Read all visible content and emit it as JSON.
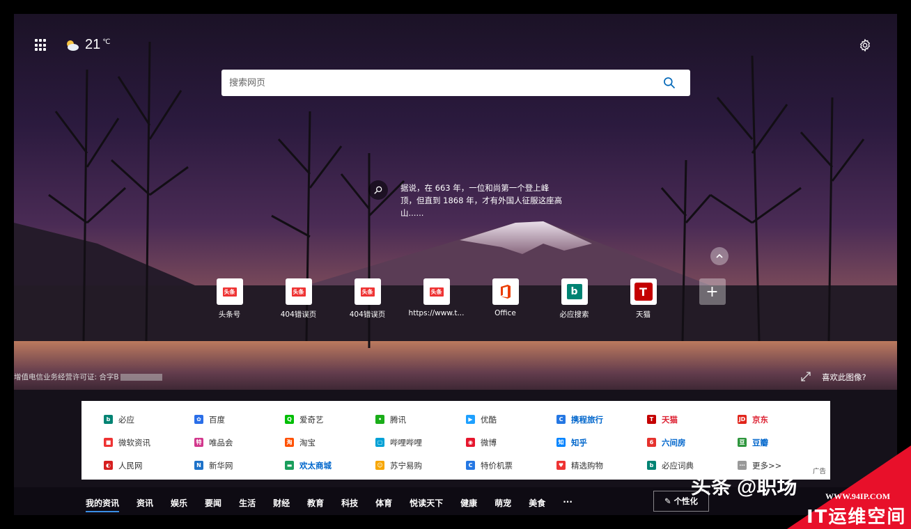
{
  "weather": {
    "temperature": "21",
    "unit": "℃",
    "icon": "partly-cloudy-icon"
  },
  "search": {
    "placeholder": "搜索网页"
  },
  "fact": {
    "text": "据说，在 663 年，一位和尚第一个登上峰顶，但直到 1868 年，才有外国人征服这座高山......"
  },
  "tiles": [
    {
      "label": "头条号",
      "icon": "toutiao-icon"
    },
    {
      "label": "404错误页",
      "icon": "toutiao-icon"
    },
    {
      "label": "404错误页",
      "icon": "toutiao-icon"
    },
    {
      "label": "https://www.t...",
      "icon": "toutiao-icon"
    },
    {
      "label": "Office",
      "icon": "office-icon"
    },
    {
      "label": "必应搜索",
      "icon": "bing-icon"
    },
    {
      "label": "天猫",
      "icon": "tmall-icon"
    }
  ],
  "footer": {
    "license": "增值电信业务经营许可证: 合字B",
    "like_image": "喜欢此图像?"
  },
  "links": [
    {
      "label": "必应",
      "color": "#008373",
      "glyph": "b"
    },
    {
      "label": "百度",
      "color": "#2a6ee8",
      "glyph": "✿"
    },
    {
      "label": "爱奇艺",
      "color": "#00be06",
      "glyph": "Q"
    },
    {
      "label": "腾讯",
      "color": "#1aad19",
      "glyph": "•"
    },
    {
      "label": "优酷",
      "color": "#1ea0ff",
      "glyph": "▶"
    },
    {
      "label": "携程旅行",
      "color": "#2577e3",
      "glyph": "C",
      "style": "blue"
    },
    {
      "label": "天猫",
      "color": "#c40000",
      "glyph": "T",
      "style": "red"
    },
    {
      "label": "京东",
      "color": "#e1251b",
      "glyph": "JD",
      "style": "red"
    },
    {
      "label": "微软资讯",
      "color": "#e33",
      "glyph": "■"
    },
    {
      "label": "唯品会",
      "color": "#d2378c",
      "glyph": "特"
    },
    {
      "label": "淘宝",
      "color": "#ff5000",
      "glyph": "淘"
    },
    {
      "label": "哔哩哔哩",
      "color": "#00a1d6",
      "glyph": "▢"
    },
    {
      "label": "微博",
      "color": "#e6162d",
      "glyph": "◉"
    },
    {
      "label": "知乎",
      "color": "#0084ff",
      "glyph": "知",
      "style": "blue"
    },
    {
      "label": "六间房",
      "color": "#e5322d",
      "glyph": "6",
      "style": "blue"
    },
    {
      "label": "豆瓣",
      "color": "#2e963d",
      "glyph": "豆",
      "style": "blue"
    },
    {
      "label": "人民网",
      "color": "#d61f1f",
      "glyph": "◐"
    },
    {
      "label": "新华网",
      "color": "#1d72c9",
      "glyph": "N"
    },
    {
      "label": "欢太商城",
      "color": "#1a9e5c",
      "glyph": "▬",
      "style": "blue"
    },
    {
      "label": "苏宁易购",
      "color": "#f7a600",
      "glyph": "☺"
    },
    {
      "label": "特价机票",
      "color": "#2577e3",
      "glyph": "C"
    },
    {
      "label": "精选购物",
      "color": "#e33",
      "glyph": "♥"
    },
    {
      "label": "必应词典",
      "color": "#008373",
      "glyph": "b"
    },
    {
      "label": "更多>>",
      "color": "#999",
      "glyph": "⋯"
    }
  ],
  "ad_label": "广告",
  "news_tabs": [
    "我的资讯",
    "资讯",
    "娱乐",
    "要闻",
    "生活",
    "财经",
    "教育",
    "科技",
    "体育",
    "悦读天下",
    "健康",
    "萌宠",
    "美食",
    "···"
  ],
  "personalize_label": "个性化",
  "watermark": {
    "text": "头条 @职场",
    "url": "WWW.94IP.COM",
    "name": "IT运维空间"
  }
}
